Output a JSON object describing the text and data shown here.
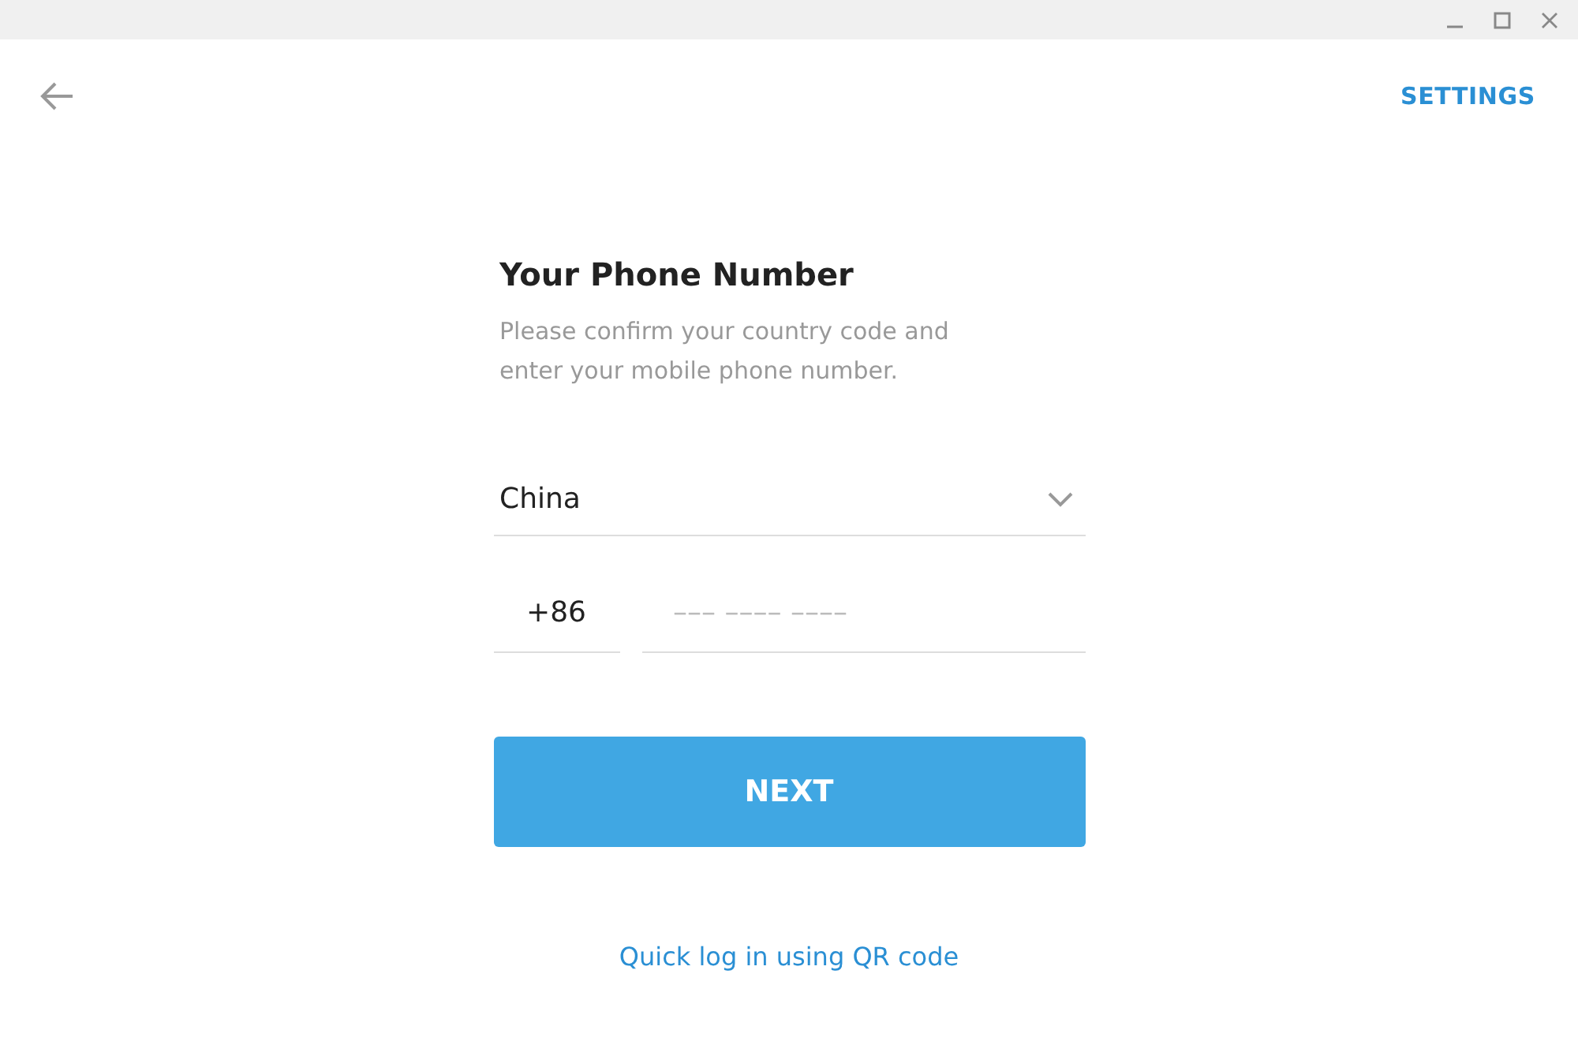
{
  "header": {
    "settings": "SETTINGS"
  },
  "title": "Your Phone Number",
  "description": "Please confirm your country code and enter your mobile phone number.",
  "country": {
    "value": "China"
  },
  "code": {
    "value": "+86"
  },
  "phone": {
    "placeholder": "––– –––– ––––"
  },
  "next_button": "NEXT",
  "qr_link": "Quick log in using QR code"
}
